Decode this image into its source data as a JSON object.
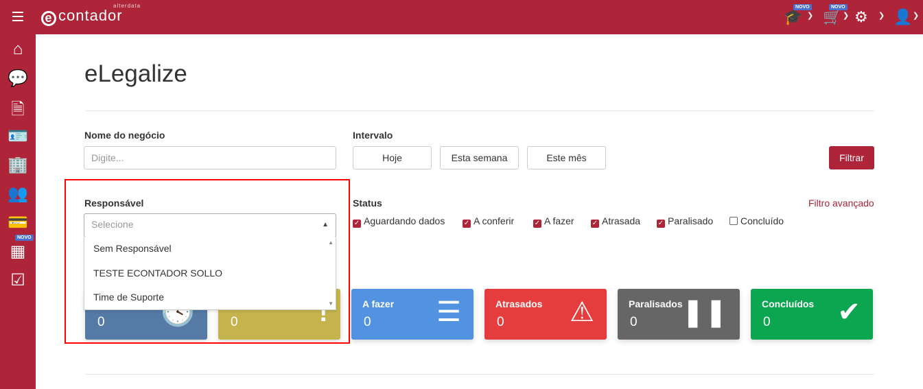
{
  "header": {
    "logo_text": "contador",
    "logo_brand": "alterdata",
    "badges": [
      "NOVO",
      "NOVO"
    ]
  },
  "sidebar": {
    "badge": "NOVO"
  },
  "page": {
    "title": "eLegalize"
  },
  "filters": {
    "nome_label": "Nome do negócio",
    "nome_placeholder": "Digite...",
    "intervalo_label": "Intervalo",
    "intervalo_buttons": [
      "Hoje",
      "Esta semana",
      "Este mês"
    ],
    "filtrar": "Filtrar",
    "responsavel_label": "Responsável",
    "responsavel_placeholder": "Selecione",
    "responsavel_options": [
      "Sem Responsável",
      "TESTE ECONTADOR SOLLO",
      "Time de Suporte"
    ],
    "status_label": "Status",
    "filtro_avancado": "Filtro avançado",
    "status": [
      {
        "label": "Aguardando dados",
        "checked": true
      },
      {
        "label": "A conferir",
        "checked": true
      },
      {
        "label": "A fazer",
        "checked": true
      },
      {
        "label": "Atrasada",
        "checked": true
      },
      {
        "label": "Paralisado",
        "checked": true
      },
      {
        "label": "Concluído",
        "checked": false
      }
    ]
  },
  "cards": [
    {
      "title": "",
      "value": "0",
      "color": "#547aa5"
    },
    {
      "title": "",
      "value": "0",
      "color": "#c5b44d"
    },
    {
      "title": "A fazer",
      "value": "0",
      "color": "#5193e0"
    },
    {
      "title": "Atrasados",
      "value": "0",
      "color": "#e53d3d"
    },
    {
      "title": "Paralisados",
      "value": "0",
      "color": "#666666"
    },
    {
      "title": "Concluídos",
      "value": "0",
      "color": "#0ca651"
    }
  ]
}
